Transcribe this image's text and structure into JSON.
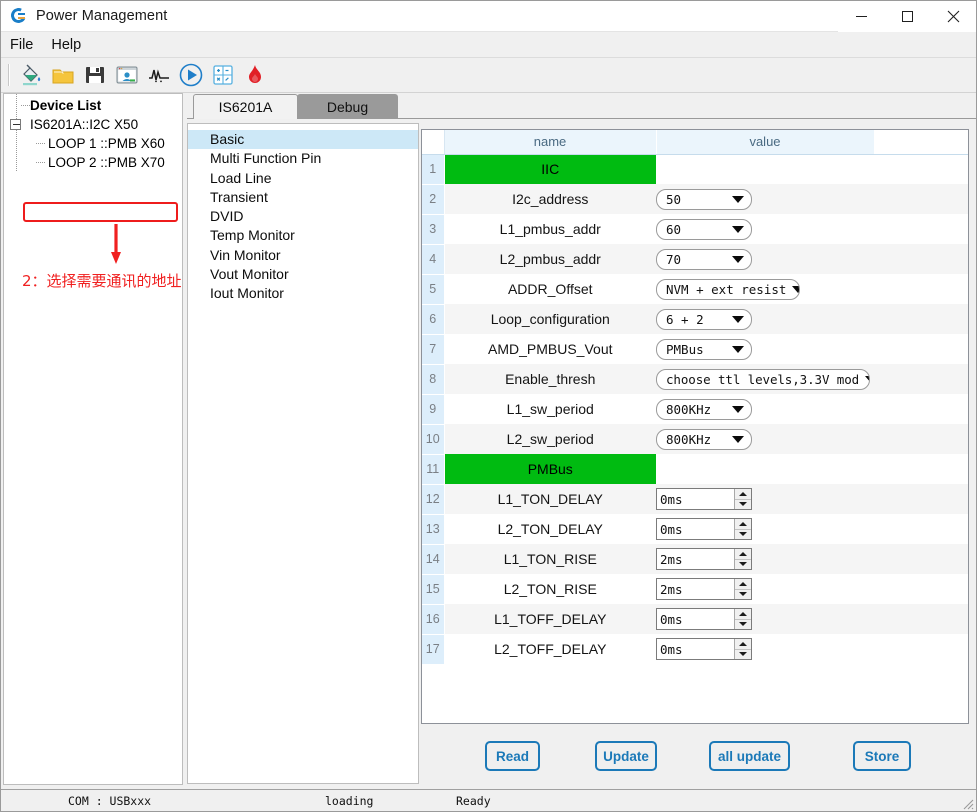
{
  "window": {
    "title": "Power Management",
    "icon": "app-logo-icon",
    "controls": {
      "minimize": "–",
      "maximize": "□",
      "close": "✕"
    }
  },
  "menu": {
    "items": [
      "File",
      "Help"
    ]
  },
  "toolbar": {
    "buttons": [
      {
        "name": "fill-color-icon",
        "title": "Fill"
      },
      {
        "name": "open-folder-icon",
        "title": "Open"
      },
      {
        "name": "save-disk-icon",
        "title": "Save"
      },
      {
        "name": "monitor-user-icon",
        "title": "Monitor"
      },
      {
        "name": "waveform-icon",
        "title": "Waveform"
      },
      {
        "name": "play-circle-icon",
        "title": "Run"
      },
      {
        "name": "calculator-icon",
        "title": "Calculator"
      },
      {
        "name": "flame-icon",
        "title": "Burn"
      }
    ]
  },
  "device_tree": {
    "header": "Device List",
    "root": "IS6201A::I2C X50",
    "children": [
      "LOOP 1 ::PMB X60",
      "LOOP 2 ::PMB X70"
    ],
    "annotation": "2：选择需要通讯的地址",
    "highlight_color": "#ee1c1c"
  },
  "tabs": [
    {
      "label": "IS6201A",
      "active": true
    },
    {
      "label": "Debug",
      "active": false
    }
  ],
  "category_list": {
    "items": [
      {
        "label": "Basic",
        "selected": true
      },
      {
        "label": "Multi Function Pin",
        "selected": false
      },
      {
        "label": "Load Line",
        "selected": false
      },
      {
        "label": "Transient",
        "selected": false
      },
      {
        "label": "DVID",
        "selected": false
      },
      {
        "label": "Temp Monitor",
        "selected": false
      },
      {
        "label": "Vin Monitor",
        "selected": false
      },
      {
        "label": "Vout Monitor",
        "selected": false
      },
      {
        "label": "Iout Monitor",
        "selected": false
      }
    ],
    "selected_color": "#cde8f7"
  },
  "table": {
    "headers": {
      "name": "name",
      "value": "value"
    },
    "section_color": "#00bb11",
    "rows": [
      {
        "index": "1",
        "name": "IIC",
        "type": "section"
      },
      {
        "index": "2",
        "name": "I2c_address",
        "type": "combo",
        "value": "50",
        "width": "sm"
      },
      {
        "index": "3",
        "name": "L1_pmbus_addr",
        "type": "combo",
        "value": "60",
        "width": "sm"
      },
      {
        "index": "4",
        "name": "L2_pmbus_addr",
        "type": "combo",
        "value": "70",
        "width": "sm"
      },
      {
        "index": "5",
        "name": "ADDR_Offset",
        "type": "combo",
        "value": "NVM + ext resist",
        "width": "md"
      },
      {
        "index": "6",
        "name": "Loop_configuration",
        "type": "combo",
        "value": "6 + 2",
        "width": "sm"
      },
      {
        "index": "7",
        "name": "AMD_PMBUS_Vout",
        "type": "combo",
        "value": "PMBus",
        "width": "sm"
      },
      {
        "index": "8",
        "name": "Enable_thresh",
        "type": "combo",
        "value": "choose ttl levels,3.3V mod",
        "width": "lg"
      },
      {
        "index": "9",
        "name": "L1_sw_period",
        "type": "combo",
        "value": "800KHz",
        "width": "sm"
      },
      {
        "index": "10",
        "name": "L2_sw_period",
        "type": "combo",
        "value": "800KHz",
        "width": "sm"
      },
      {
        "index": "11",
        "name": "PMBus",
        "type": "section"
      },
      {
        "index": "12",
        "name": "L1_TON_DELAY",
        "type": "spin",
        "value": "0ms"
      },
      {
        "index": "13",
        "name": "L2_TON_DELAY",
        "type": "spin",
        "value": "0ms"
      },
      {
        "index": "14",
        "name": "L1_TON_RISE",
        "type": "spin",
        "value": "2ms"
      },
      {
        "index": "15",
        "name": "L2_TON_RISE",
        "type": "spin",
        "value": "2ms"
      },
      {
        "index": "16",
        "name": "L1_TOFF_DELAY",
        "type": "spin",
        "value": "0ms"
      },
      {
        "index": "17",
        "name": "L2_TOFF_DELAY",
        "type": "spin",
        "value": "0ms"
      }
    ]
  },
  "actions": {
    "read": "Read",
    "update": "Update",
    "all_update": "all update",
    "store": "Store",
    "accent_color": "#1b79b8"
  },
  "statusbar": {
    "com": "COM : USBxxx",
    "loading": "loading",
    "ready": "Ready"
  }
}
